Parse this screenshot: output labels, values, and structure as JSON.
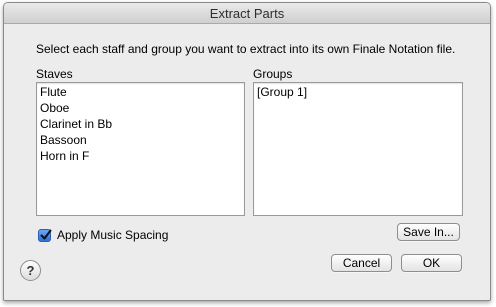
{
  "window": {
    "title": "Extract Parts"
  },
  "instruction": "Select each staff and group you want to extract into its own Finale Notation file.",
  "staves": {
    "label": "Staves",
    "items": [
      "Flute",
      "Oboe",
      "Clarinet in Bb",
      "Bassoon",
      "Horn in F"
    ]
  },
  "groups": {
    "label": "Groups",
    "items": [
      "[Group 1]"
    ]
  },
  "apply_spacing": {
    "label": "Apply Music Spacing",
    "checked": true
  },
  "buttons": {
    "save_in": "Save In...",
    "cancel": "Cancel",
    "ok": "OK",
    "help": "?"
  }
}
